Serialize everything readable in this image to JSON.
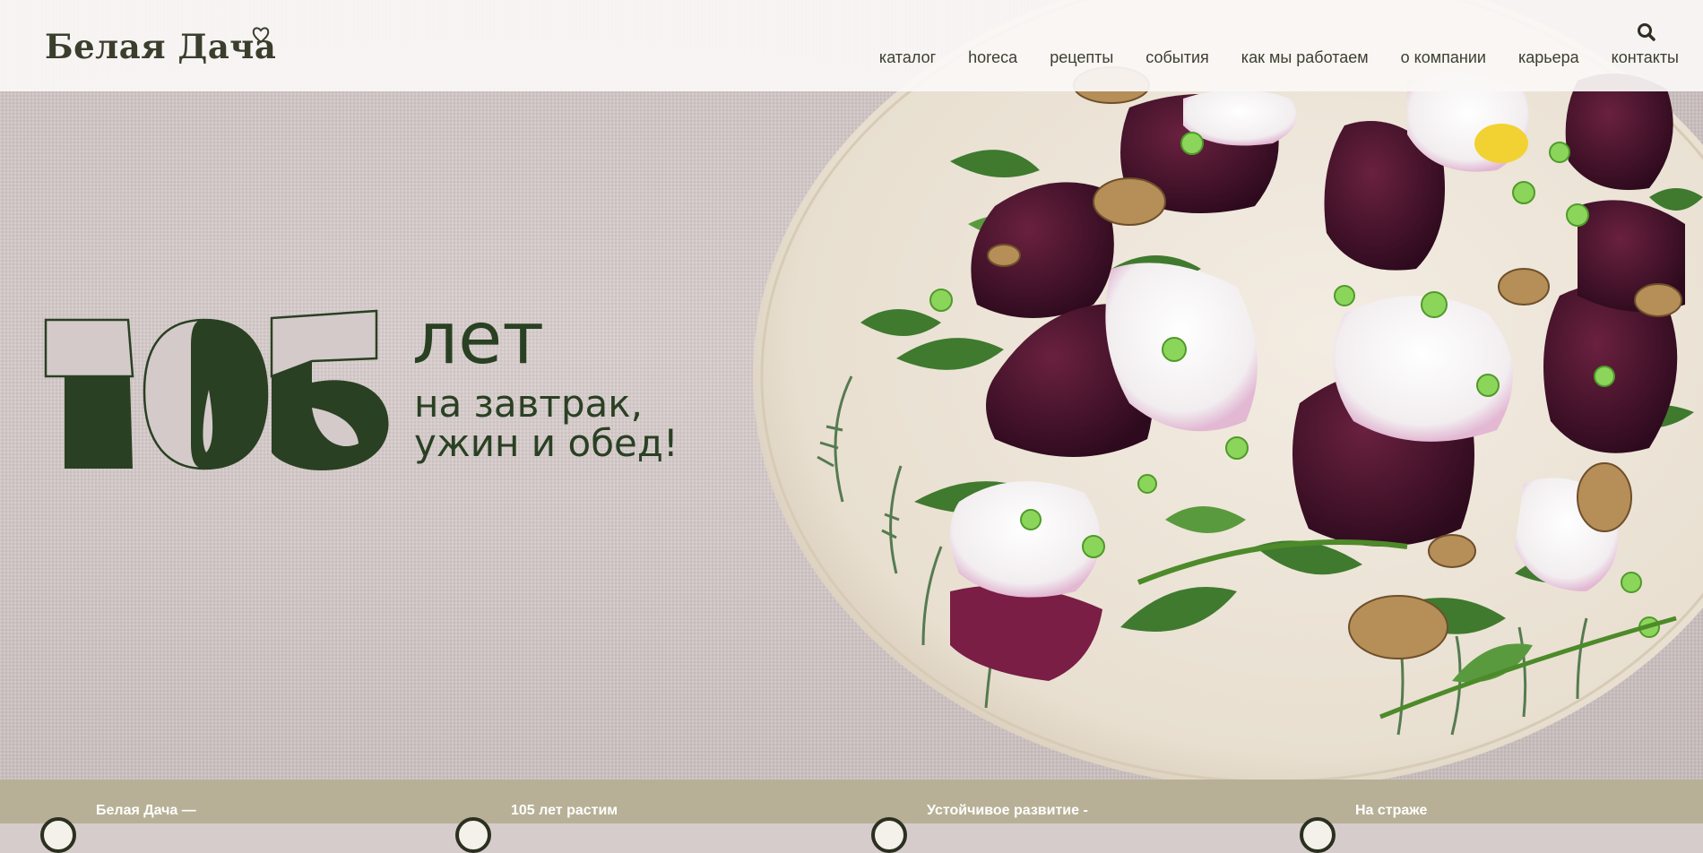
{
  "brand": {
    "name": "Белая Дача"
  },
  "header": {
    "search_icon": "search-icon",
    "nav": [
      {
        "label": "каталог"
      },
      {
        "label": "horeca"
      },
      {
        "label": "рецепты"
      },
      {
        "label": "события"
      },
      {
        "label": "как мы работаем"
      },
      {
        "label": "о компании"
      },
      {
        "label": "карьера"
      },
      {
        "label": "контакты"
      }
    ]
  },
  "hero": {
    "number": "105",
    "years": "лет",
    "subtitle_line1": "на завтрак,",
    "subtitle_line2": "ужин и обед!"
  },
  "features": [
    {
      "title": "Белая Дача —"
    },
    {
      "title": "105 лет растим"
    },
    {
      "title": "Устойчивое развитие -"
    },
    {
      "title": "На страже"
    }
  ],
  "colors": {
    "brand_green": "#2a4023",
    "header_bg": "#faf8f6",
    "strip_bg": "#b7b096",
    "text_dark": "#3b3f2f"
  }
}
